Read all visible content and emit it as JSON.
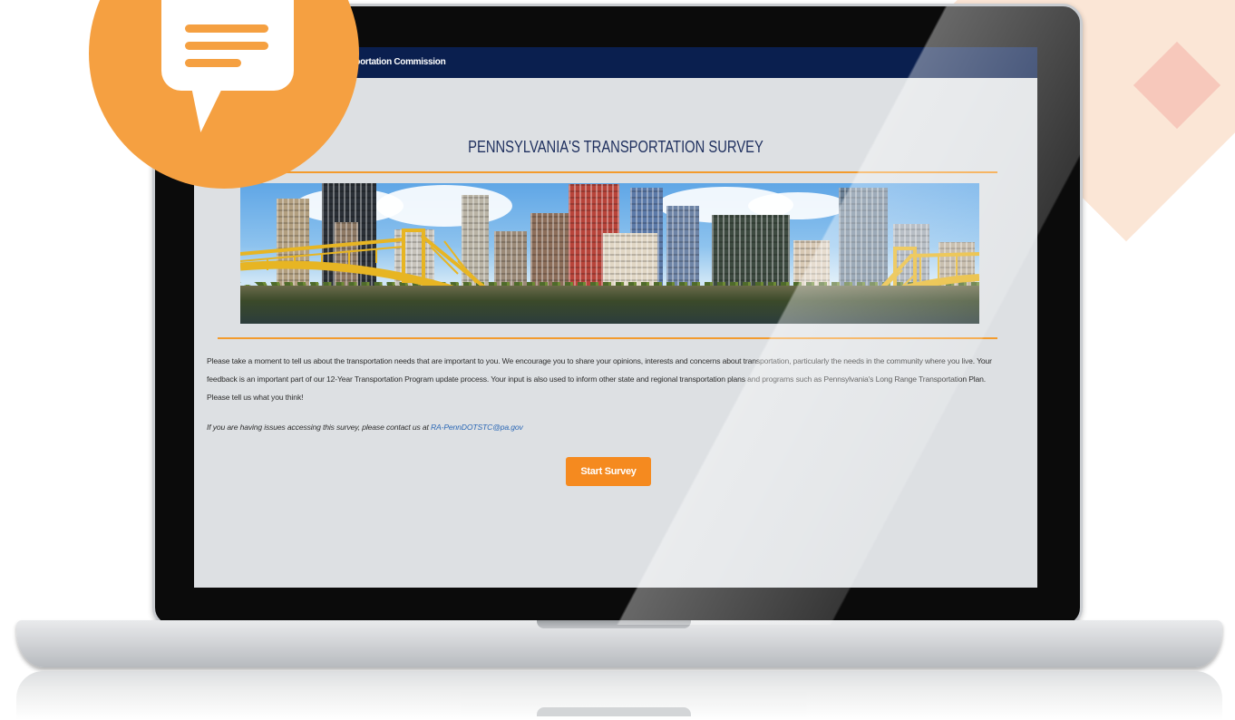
{
  "screen": {
    "header_text": "sportation Commission",
    "title": "PENNSYLVANIA'S TRANSPORTATION SURVEY",
    "banner_image": "pittsburgh-skyline-bridges",
    "description": "Please take a moment to tell us about the transportation needs that are important to you. We encourage you to share your opinions, interests and concerns about transportation, particularly the needs in the community where you live. Your feedback is an important part of our 12-Year Transportation Program update process. Your input is also used to inform other state and regional transportation plans and programs such as Pennsylvania's Long Range Transportation Plan. Please tell us what you think!",
    "contact_text": "If you are having issues accessing this survey, please contact us at ",
    "contact_email": "RA-PennDOTSTC@pa.gov",
    "start_button": "Start Survey"
  },
  "colors": {
    "header_bg": "#0a1f4f",
    "accent_orange": "#f39b2d",
    "button_bg": "#f58a1f",
    "title_color": "#1e2f5e",
    "link_color": "#2a67b5",
    "chat_icon": "#f5a041"
  },
  "icons": {
    "chat": "chat-bubble-icon"
  }
}
